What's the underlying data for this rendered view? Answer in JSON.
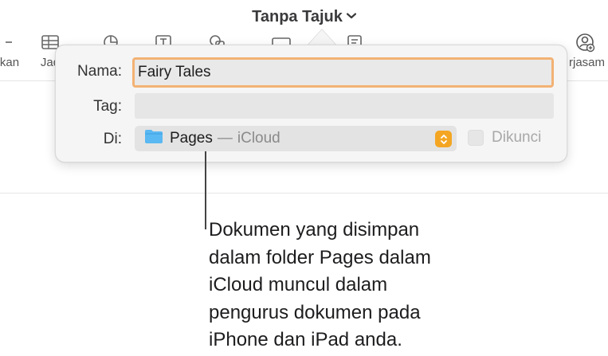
{
  "window": {
    "title": "Tanpa Tajuk"
  },
  "toolbar": {
    "left_label": "kan",
    "table_label": "Jad",
    "collab_label": "rjasam"
  },
  "dialog": {
    "name_label": "Nama:",
    "name_value": "Fairy Tales",
    "tag_label": "Tag:",
    "tag_value": "",
    "location_label": "Di:",
    "location_folder": "Pages",
    "location_dash": "—",
    "location_service": "iCloud",
    "locked_label": "Dikunci"
  },
  "callout": {
    "lines": [
      "Dokumen yang disimpan",
      "dalam folder Pages dalam",
      "iCloud muncul dalam",
      "pengurus dokumen pada",
      "iPhone dan iPad anda."
    ]
  },
  "colors": {
    "focus_ring": "#f3b274",
    "stepper": "#f4a623",
    "folder": "#5ab8f2"
  }
}
